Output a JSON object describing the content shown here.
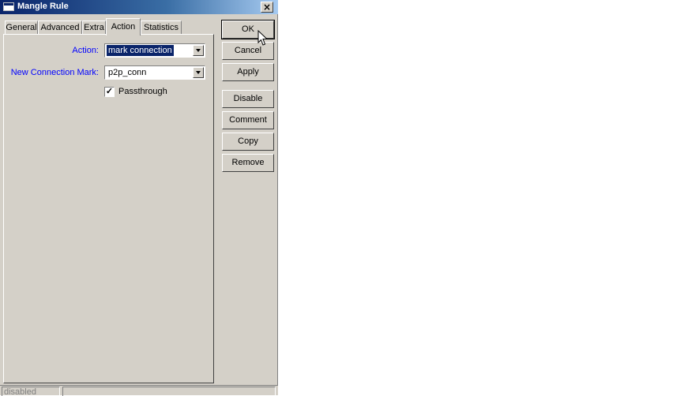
{
  "window": {
    "title": "Mangle Rule",
    "close_label": "×"
  },
  "tabs": [
    {
      "label": "General"
    },
    {
      "label": "Advanced"
    },
    {
      "label": "Extra"
    },
    {
      "label": "Action"
    },
    {
      "label": "Statistics"
    }
  ],
  "active_tab": "Action",
  "form": {
    "action_label": "Action:",
    "action_value": "mark connection",
    "conn_mark_label": "New Connection Mark:",
    "conn_mark_value": "p2p_conn",
    "passthrough_label": "Passthrough",
    "passthrough_checked": true
  },
  "buttons": {
    "ok": "OK",
    "cancel": "Cancel",
    "apply": "Apply",
    "disable": "Disable",
    "comment": "Comment",
    "copy": "Copy",
    "remove": "Remove"
  },
  "status": {
    "text": "disabled"
  },
  "colors": {
    "title_bar": "#0a246a",
    "label_blue": "#0000ff",
    "face": "#d4d0c8"
  }
}
